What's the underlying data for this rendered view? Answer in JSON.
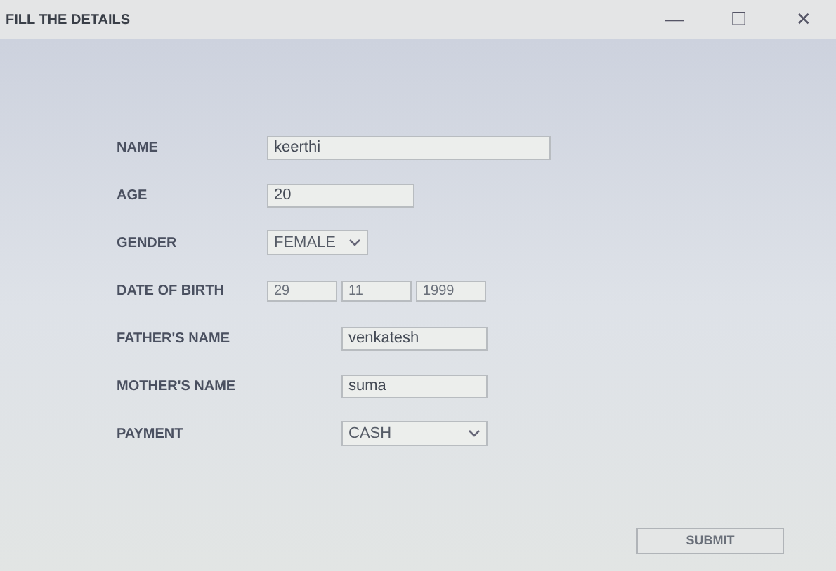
{
  "window": {
    "title": "FILL THE DETAILS",
    "controls": [
      "—",
      "☐",
      "✕"
    ]
  },
  "personal": [
    {
      "label": "NAME",
      "kind": "text",
      "value": "keerthi"
    },
    {
      "label": "AGE",
      "kind": "text",
      "value": "20"
    },
    {
      "label": "GENDER",
      "kind": "select",
      "value": "FEMALE"
    },
    {
      "label": "DATE OF BIRTH",
      "kind": "date",
      "parts": [
        "29",
        "11",
        "1999"
      ]
    }
  ],
  "family": [
    {
      "label": "FATHER'S NAME",
      "kind": "text",
      "value": "venkatesh"
    },
    {
      "label": "MOTHER'S NAME",
      "kind": "text",
      "value": "suma"
    },
    {
      "label": "PAYMENT",
      "kind": "select",
      "value": "CASH"
    }
  ],
  "submit": "SUBMIT"
}
